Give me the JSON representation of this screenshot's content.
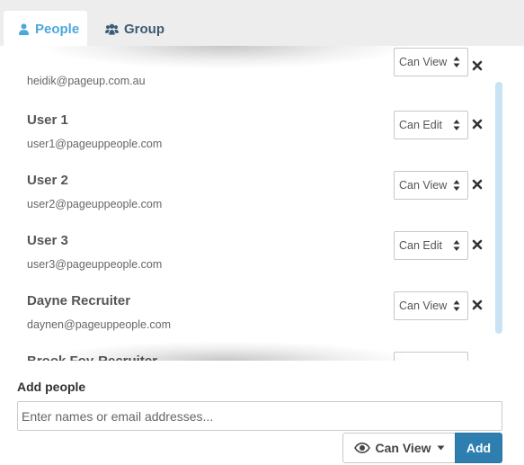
{
  "tabs": {
    "people": {
      "label": "People",
      "icon": "user-icon",
      "active": true,
      "color": "#4aa8dd"
    },
    "group": {
      "label": "Group",
      "icon": "users-icon",
      "active": false,
      "color": "#3d5a75"
    }
  },
  "people": [
    {
      "name": "",
      "email": "heidik@pageup.com.au",
      "permission": "Can View"
    },
    {
      "name": "User 1",
      "email": "user1@pageuppeople.com",
      "permission": "Can Edit"
    },
    {
      "name": "User 2",
      "email": "user2@pageuppeople.com",
      "permission": "Can View"
    },
    {
      "name": "User 3",
      "email": "user3@pageuppeople.com",
      "permission": "Can Edit"
    },
    {
      "name": "Dayne Recruiter",
      "email": "daynen@pageuppeople.com",
      "permission": "Can View"
    },
    {
      "name": "Brook Foy-Recruiter",
      "email": "",
      "permission": ""
    }
  ],
  "add_people": {
    "label": "Add people",
    "placeholder": "Enter names or email addresses...",
    "permission_label": "Can View",
    "permission_icon": "eye-icon",
    "add_label": "Add",
    "add_color": "#2e7fb0"
  }
}
